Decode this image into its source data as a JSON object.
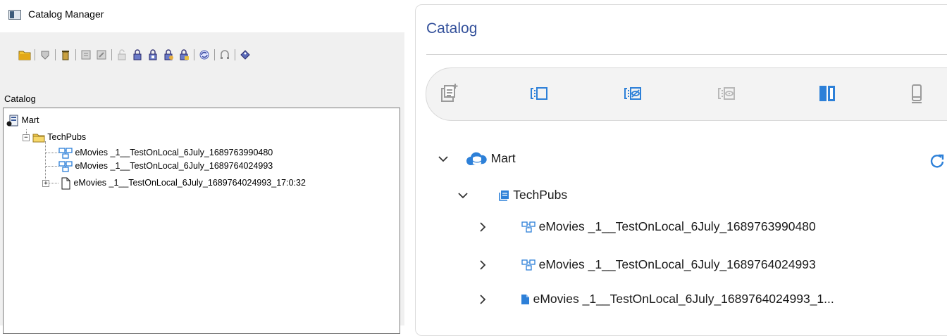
{
  "app": {
    "window_title": "Catalog Manager"
  },
  "left_panel": {
    "catalog_label": "Catalog",
    "tree": {
      "root": "Mart",
      "folder": "TechPubs",
      "items": [
        "eMovies _1__TestOnLocal_6July_1689763990480",
        "eMovies _1__TestOnLocal_6July_1689764024993",
        "eMovies _1__TestOnLocal_6July_1689764024993_17:0:32"
      ]
    }
  },
  "right_panel": {
    "title": "Catalog",
    "tree": {
      "root": "Mart",
      "folder": "TechPubs",
      "items": [
        "eMovies _1__TestOnLocal_6July_1689763990480",
        "eMovies _1__TestOnLocal_6July_1689764024993",
        "eMovies _1__TestOnLocal_6July_1689764024993_1..."
      ]
    }
  },
  "colors": {
    "accent_blue": "#34519b",
    "icon_blue": "#2d80d8",
    "folder_yellow": "#f2c94c"
  }
}
